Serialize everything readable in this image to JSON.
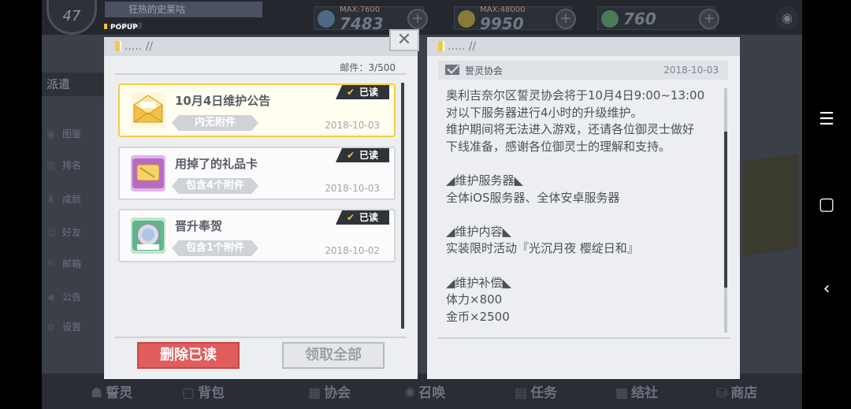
{
  "hud": {
    "level": "47",
    "banner": "狂热的史莱咕",
    "name": "sama",
    "res1_max": "MAX:7600",
    "res1_val": "7483",
    "res2_max": "MAX:48000",
    "res2_val": "9950",
    "res3_val": "760"
  },
  "popup_tag": "POPUP",
  "side_menu": {
    "dispatch": "派遣",
    "items": [
      "图鉴",
      "排名",
      "成就",
      "好友",
      "邮箱",
      "公告",
      "设置"
    ]
  },
  "bottom_nav": [
    "誓灵",
    "背包",
    "协会",
    "召唤",
    "任务",
    "结社",
    "商店"
  ],
  "left_panel": {
    "header": "..... //",
    "mail_count_label": "邮件：3/500",
    "mails": [
      {
        "title": "10月4日维护公告",
        "attachment": "内无附件",
        "date": "2018-10-03",
        "read_label": "已读"
      },
      {
        "title": "用掉了的礼品卡",
        "attachment": "包含4个附件",
        "date": "2018-10-03",
        "read_label": "已读"
      },
      {
        "title": "晋升奉贺",
        "attachment": "包含1个附件",
        "date": "2018-10-02",
        "read_label": "已读"
      }
    ],
    "delete_read_label": "删除已读",
    "claim_all_label": "领取全部"
  },
  "right_panel": {
    "header": "..... //",
    "sender": "誓灵协会",
    "date": "2018-10-03",
    "body_lines": [
      "奥利吉奈尔区誓灵协会将于10月4日9:00~13:00",
      "对以下服务器进行4小时的升级维护。",
      "维护期间将无法进入游戏，还请各位御灵士做好",
      "下线准备，感谢各位御灵士的理解和支持。",
      "",
      "◢维护服务器◣",
      "全体iOS服务器、全体安卓服务器",
      "",
      "◢维护内容◣",
      "实装限时活动『光沉月夜 樱绽日和』",
      "",
      "◢维护补偿◣",
      "体力×800",
      "金币×2500"
    ]
  },
  "close_label": "✕",
  "icons": {
    "close": "close-icon",
    "mail": "envelope-icon",
    "check": "check-icon"
  }
}
